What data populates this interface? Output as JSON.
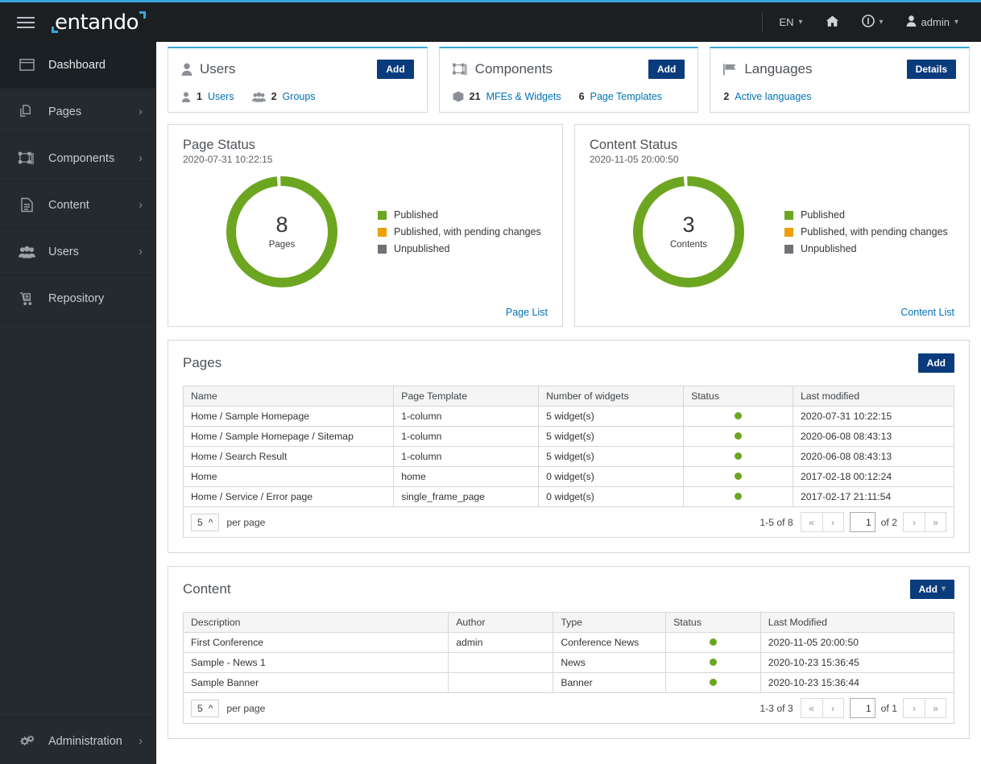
{
  "topbar": {
    "brand": "entando",
    "menu_icon": "hamburger-icon",
    "language": "EN",
    "home_icon": "home-icon",
    "info_icon": "info-circle-icon",
    "user": "admin",
    "accent": "#39a5dc",
    "background": "#1b1f22"
  },
  "sidebar": {
    "items": [
      {
        "label": "Dashboard",
        "icon": "dashboard-icon",
        "active": true,
        "expandable": false
      },
      {
        "label": "Pages",
        "icon": "pages-icon",
        "active": false,
        "expandable": true
      },
      {
        "label": "Components",
        "icon": "components-icon",
        "active": false,
        "expandable": true
      },
      {
        "label": "Content",
        "icon": "content-icon",
        "active": false,
        "expandable": true
      },
      {
        "label": "Users",
        "icon": "users-icon",
        "active": false,
        "expandable": true
      },
      {
        "label": "Repository",
        "icon": "repository-icon",
        "active": false,
        "expandable": false
      }
    ],
    "bottom": {
      "label": "Administration",
      "icon": "gears-icon",
      "expandable": true
    }
  },
  "stat_cards": [
    {
      "title": "Users",
      "title_icon": "user-icon",
      "action": "Add",
      "metrics": [
        {
          "icon": "user-icon",
          "num": "1",
          "label": "Users"
        },
        {
          "icon": "group-icon",
          "num": "2",
          "label": "Groups"
        }
      ]
    },
    {
      "title": "Components",
      "title_icon": "components-icon",
      "action": "Add",
      "metrics": [
        {
          "icon": "cube-icon",
          "num": "21",
          "label": "MFEs & Widgets"
        },
        {
          "icon": "",
          "num": "6",
          "label": "Page Templates"
        }
      ]
    },
    {
      "title": "Languages",
      "title_icon": "flag-icon",
      "action": "Details",
      "metrics": [
        {
          "icon": "",
          "num": "2",
          "label": "Active languages"
        }
      ]
    }
  ],
  "chart_data": [
    {
      "type": "pie",
      "title": "Page Status",
      "subtitle": "2020-07-31 10:22:15",
      "center_value": "8",
      "center_label": "Pages",
      "categories": [
        "Published",
        "Published, with pending changes",
        "Unpublished"
      ],
      "values": [
        8,
        0,
        0
      ],
      "colors": [
        "#6ca621",
        "#ec9f08",
        "#6e7276"
      ],
      "legend_position": "right",
      "link": "Page List"
    },
    {
      "type": "pie",
      "title": "Content Status",
      "subtitle": "2020-11-05 20:00:50",
      "center_value": "3",
      "center_label": "Contents",
      "categories": [
        "Published",
        "Published, with pending changes",
        "Unpublished"
      ],
      "values": [
        3,
        0,
        0
      ],
      "colors": [
        "#6ca621",
        "#ec9f08",
        "#6e7276"
      ],
      "legend_position": "right",
      "link": "Content List"
    }
  ],
  "pages_panel": {
    "title": "Pages",
    "action": "Add",
    "columns": [
      "Name",
      "Page Template",
      "Number of widgets",
      "Status",
      "Last modified"
    ],
    "rows": [
      [
        "Home / Sample Homepage",
        "1-column",
        "5 widget(s)",
        "published",
        "2020-07-31 10:22:15"
      ],
      [
        "Home / Sample Homepage / Sitemap",
        "1-column",
        "5 widget(s)",
        "published",
        "2020-06-08 08:43:13"
      ],
      [
        "Home / Search Result",
        "1-column",
        "5 widget(s)",
        "published",
        "2020-06-08 08:43:13"
      ],
      [
        "Home",
        "home",
        "0 widget(s)",
        "published",
        "2017-02-18 00:12:24"
      ],
      [
        "Home / Service / Error page",
        "single_frame_page",
        "0 widget(s)",
        "published",
        "2017-02-17 21:11:54"
      ]
    ],
    "pager": {
      "per_page_value": "5",
      "per_page_label": "per page",
      "range": "1-5 of 8",
      "current_page": "1",
      "of_label": "of 2",
      "first": "«",
      "prev": "‹",
      "next": "›",
      "last": "»"
    }
  },
  "content_panel": {
    "title": "Content",
    "action": "Add",
    "columns": [
      "Description",
      "Author",
      "Type",
      "Status",
      "Last Modified"
    ],
    "rows": [
      [
        "First Conference",
        "admin",
        "Conference News",
        "published",
        "2020-11-05 20:00:50"
      ],
      [
        "Sample - News 1",
        "",
        "News",
        "published",
        "2020-10-23 15:36:45"
      ],
      [
        "Sample Banner",
        "",
        "Banner",
        "published",
        "2020-10-23 15:36:44"
      ]
    ],
    "pager": {
      "per_page_value": "5",
      "per_page_label": "per page",
      "range": "1-3 of 3",
      "current_page": "1",
      "of_label": "of 1",
      "first": "«",
      "prev": "‹",
      "next": "›",
      "last": "»"
    }
  },
  "colors": {
    "accent_blue": "#39a5dc",
    "button_blue": "#0a3c7d",
    "link_blue": "#0071b6",
    "published_green": "#6ca621",
    "pending_orange": "#ec9f08",
    "unpublished_gray": "#6e7276"
  }
}
